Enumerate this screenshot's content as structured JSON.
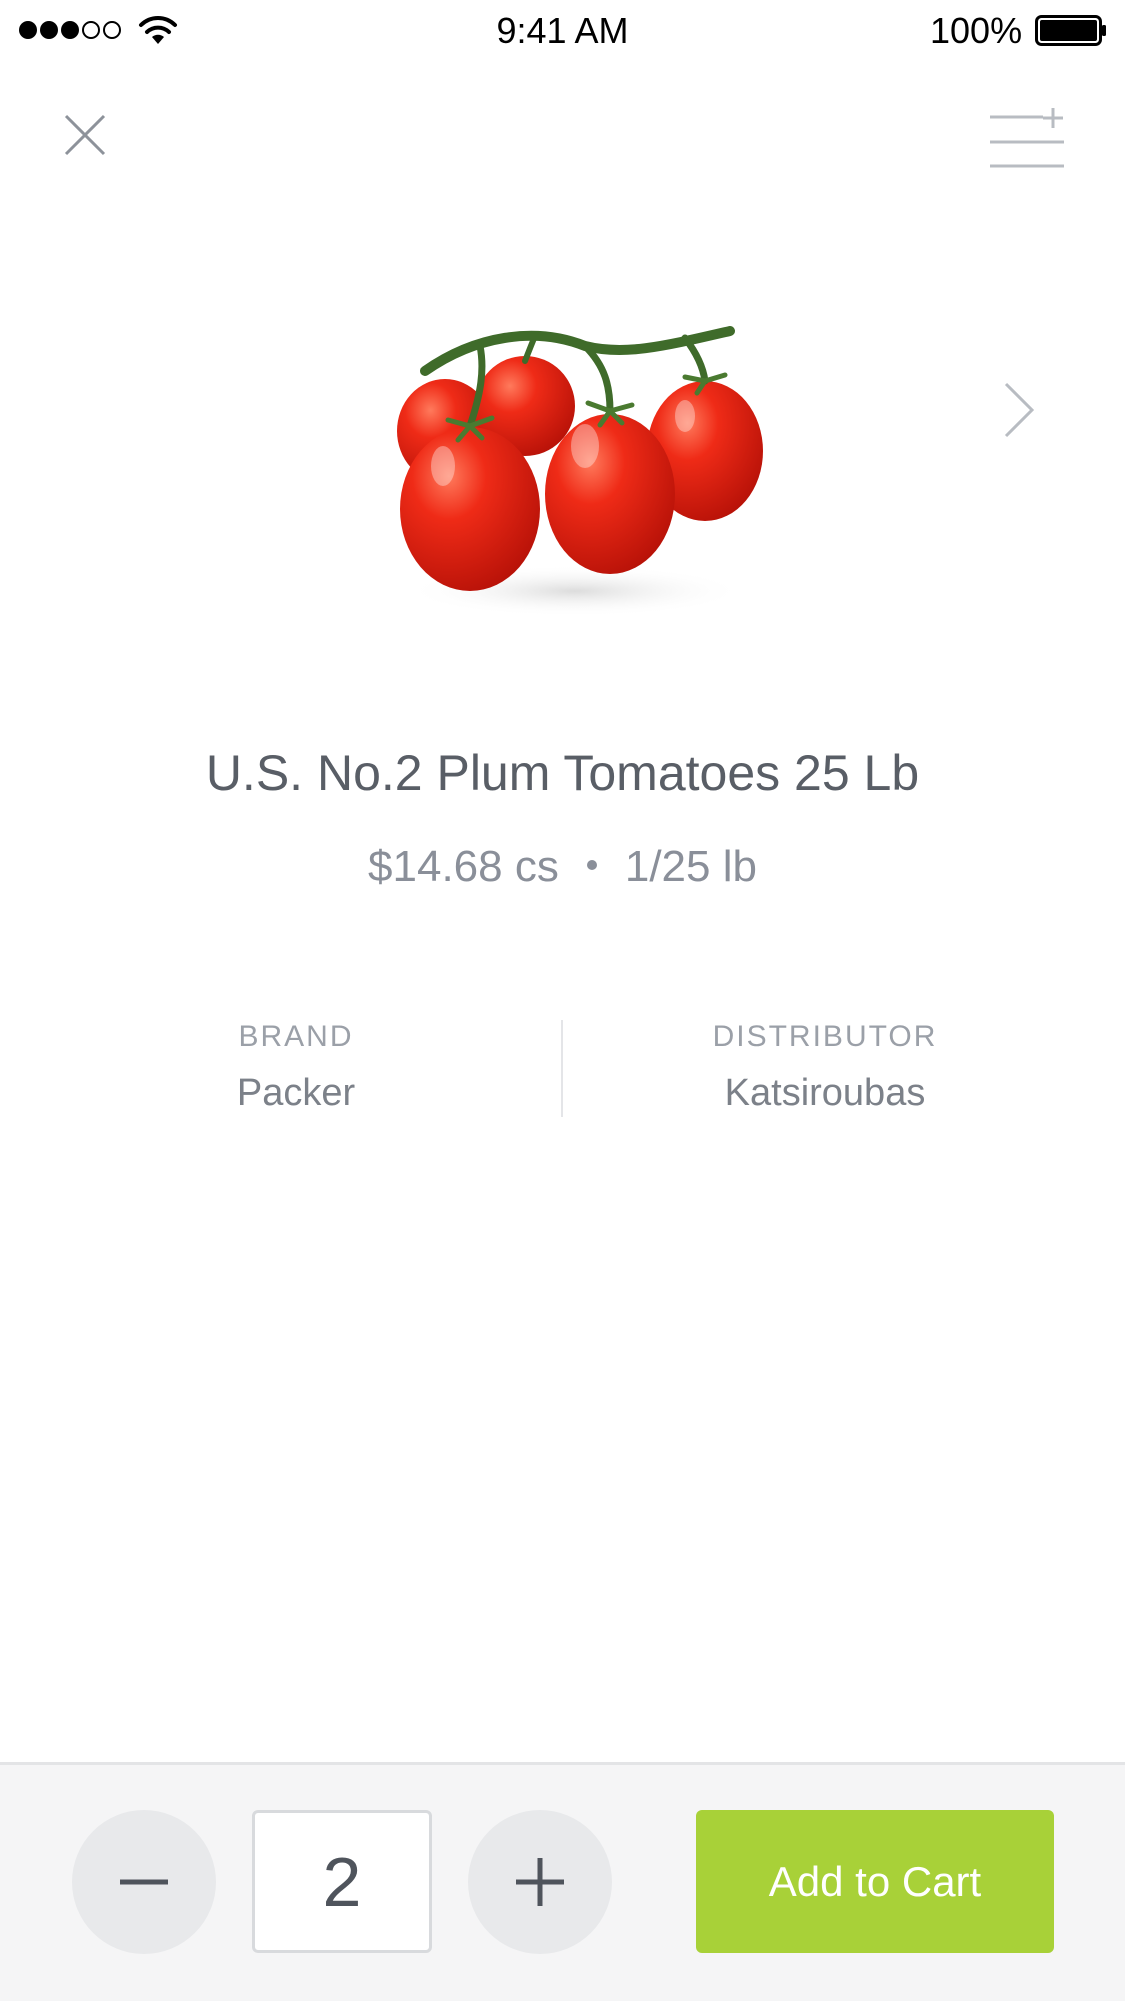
{
  "status_bar": {
    "time": "9:41 AM",
    "battery_percent": "100%",
    "signal_bars_filled": 3,
    "signal_bars_total": 5
  },
  "header": {
    "close_icon": "close-icon",
    "add_to_list_icon": "add-to-list-icon"
  },
  "product": {
    "image_icon": "tomato-photo",
    "title": "U.S. No.2 Plum Tomatoes 25 Lb",
    "price": "$14.68 cs",
    "pack_size": "1/25 lb",
    "brand_label": "BRAND",
    "brand_value": "Packer",
    "distributor_label": "DISTRIBUTOR",
    "distributor_value": "Katsiroubas"
  },
  "cart": {
    "quantity": "2",
    "add_label": "Add to Cart"
  },
  "colors": {
    "accent_green": "#a8d138",
    "text_primary": "#595e66",
    "text_secondary": "#8a8f99",
    "bottom_bar_bg": "#f5f5f6",
    "stepper_bg": "#e8e9eb"
  }
}
